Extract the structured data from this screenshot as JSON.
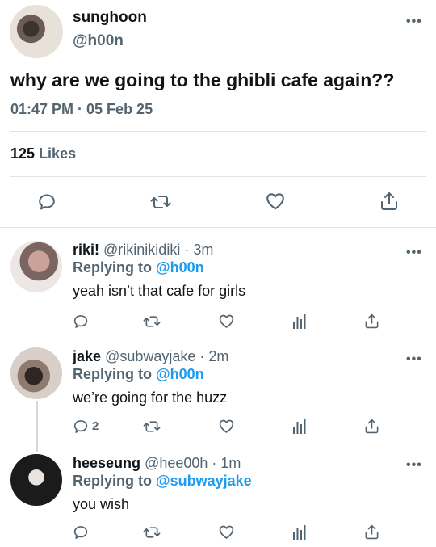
{
  "main_tweet": {
    "display_name": "sunghoon",
    "handle": "@h00n",
    "text": "why are we going to the ghibli cafe again??",
    "meta": "01:47 PM · 05 Feb 25",
    "likes_count": "125",
    "likes_label": "Likes",
    "more_icon": "•••",
    "actions": [
      "reply-icon",
      "retweet-icon",
      "like-icon",
      "share-icon"
    ]
  },
  "replies": [
    {
      "display_name": "riki!",
      "handle": "@rikinikidiki",
      "separator": "·",
      "time": "3m",
      "replying_prefix": "Replying to",
      "replying_to": "@h00n",
      "text": "yeah isn’t that cafe for girls",
      "reply_count": "",
      "more_icon": "•••"
    },
    {
      "display_name": "jake",
      "handle": "@subwayjake",
      "separator": "·",
      "time": "2m",
      "replying_prefix": "Replying to",
      "replying_to": "@h00n",
      "text": "we’re going for the huzz",
      "reply_count": "2",
      "more_icon": "•••"
    },
    {
      "display_name": "heeseung",
      "handle": "@hee00h",
      "separator": "·",
      "time": "1m",
      "replying_prefix": "Replying to",
      "replying_to": "@subwayjake",
      "text": "you wish",
      "reply_count": "",
      "more_icon": "•••"
    }
  ],
  "colors": {
    "text": "#0f1419",
    "secondary": "#536471",
    "accent": "#1d9bf0",
    "divider": "#dfe3e7"
  }
}
